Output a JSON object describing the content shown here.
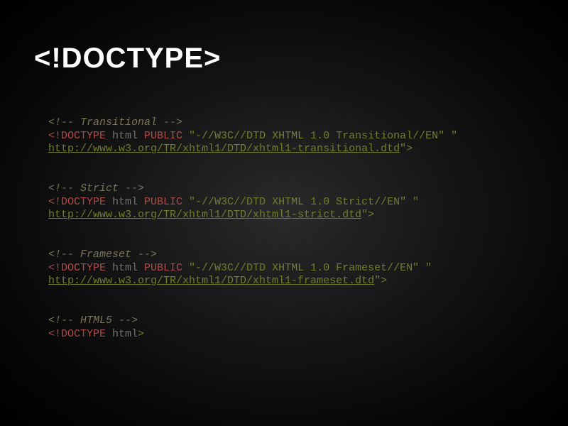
{
  "title": "<!DOCTYPE>",
  "blocks": [
    {
      "comment": "<!-- Transitional -->",
      "doctype": "<!DOCTYPE",
      "html": " html ",
      "public": "PUBLIC",
      "fpi": " \"-//W3C//DTD XHTML 1.0 Transitional//EN\" \"",
      "url": "http://www.w3.org/TR/xhtml1/DTD/xhtml1-transitional.dtd",
      "close": "\">"
    },
    {
      "comment": "<!-- Strict -->",
      "doctype": "<!DOCTYPE",
      "html": " html ",
      "public": "PUBLIC",
      "fpi": " \"-//W3C//DTD XHTML 1.0 Strict//EN\" \"",
      "url": "http://www.w3.org/TR/xhtml1/DTD/xhtml1-strict.dtd",
      "close": "\">"
    },
    {
      "comment": "<!-- Frameset -->",
      "doctype": "<!DOCTYPE",
      "html": " html ",
      "public": "PUBLIC",
      "fpi": " \"-//W3C//DTD XHTML 1.0 Frameset//EN\" \"",
      "url": "http://www.w3.org/TR/xhtml1/DTD/xhtml1-frameset.dtd",
      "close": "\">"
    }
  ],
  "html5": {
    "comment": "<!-- HTML5 -->",
    "doctype": "<!DOCTYPE",
    "html": " html",
    "close": ">"
  }
}
